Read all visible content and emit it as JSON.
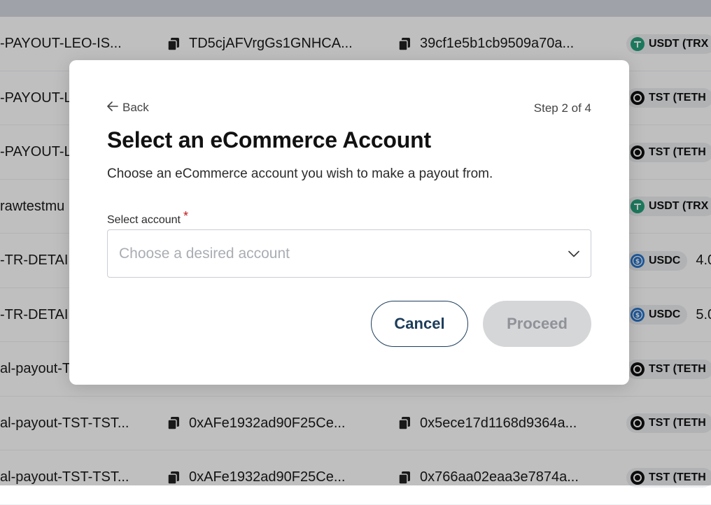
{
  "background_rows": [
    {
      "id": "-PAYOUT-LEO-IS...",
      "address": "TD5cjAFVrgGs1GNHCA...",
      "hash": "39cf1e5b1cb9509a70a...",
      "currency": "USDT (TRX",
      "coin": "tether",
      "amount": ""
    },
    {
      "id": "-PAYOUT-L",
      "address": "",
      "hash": "",
      "currency": "TST (TETH",
      "coin": "tst",
      "amount": ""
    },
    {
      "id": "-PAYOUT-L",
      "address": "",
      "hash": "",
      "currency": "TST (TETH",
      "coin": "tst",
      "amount": ""
    },
    {
      "id": "rawtestmu",
      "address": "",
      "hash": "",
      "currency": "USDT (TRX",
      "coin": "tether",
      "amount": ""
    },
    {
      "id": "-TR-DETAI",
      "address": "",
      "hash": "",
      "currency": "USDC",
      "coin": "usdc",
      "amount": "4.0"
    },
    {
      "id": "-TR-DETAI",
      "address": "",
      "hash": "",
      "currency": "USDC",
      "coin": "usdc",
      "amount": "5.0"
    },
    {
      "id": "al-payout-T",
      "address": "",
      "hash": "",
      "currency": "TST (TETH",
      "coin": "tst",
      "amount": ""
    },
    {
      "id": "al-payout-TST-TST...",
      "address": "0xAFe1932ad90F25Ce...",
      "hash": "0x5ece17d1168d9364a...",
      "currency": "TST (TETH",
      "coin": "tst",
      "amount": ""
    },
    {
      "id": "al-payout-TST-TST...",
      "address": "0xAFe1932ad90F25Ce...",
      "hash": "0x766aa02eaa3e7874a...",
      "currency": "TST (TETH",
      "coin": "tst",
      "amount": ""
    }
  ],
  "modal": {
    "back_label": "Back",
    "step_label": "Step 2 of 4",
    "title": "Select an eCommerce Account",
    "description": "Choose an eCommerce account you wish to make a payout from.",
    "select_label": "Select account",
    "required_mark": "*",
    "select_placeholder": "Choose a desired account",
    "cancel_label": "Cancel",
    "proceed_label": "Proceed",
    "proceed_disabled": true
  },
  "colors": {
    "tether": "#26a17b",
    "usdc": "#2775ca",
    "tst": "#111111",
    "cancel_border": "#1c3d5a",
    "required": "#c01818"
  },
  "icons": {
    "back": "arrow-left-icon",
    "select": "chevron-down-icon",
    "copy": "copy-icon"
  }
}
